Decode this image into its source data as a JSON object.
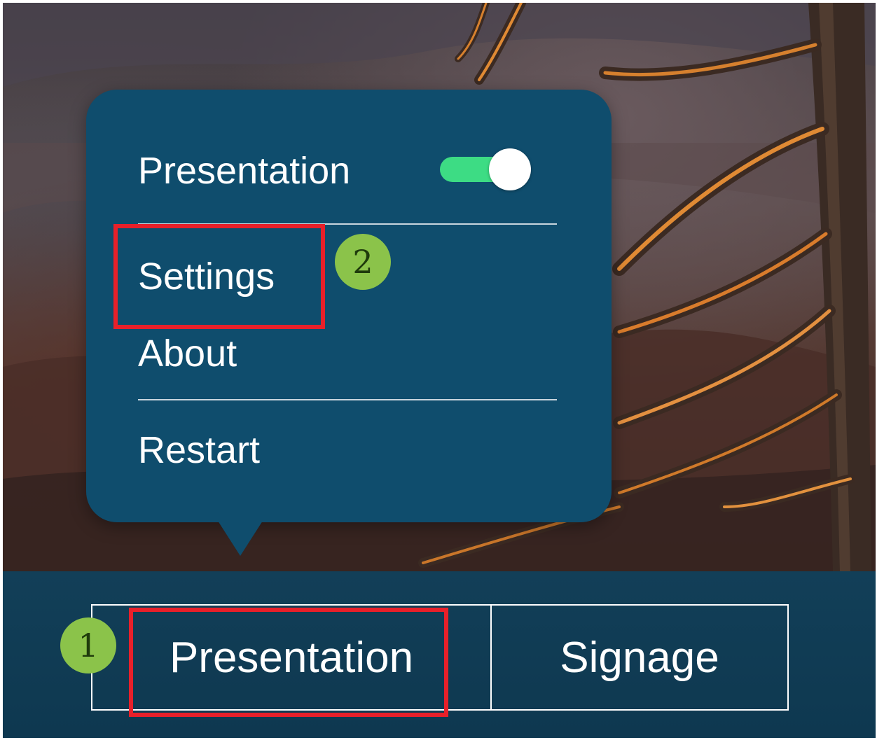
{
  "popup_menu": {
    "toggle_label": "Presentation",
    "toggle_state": "on",
    "items": [
      {
        "label": "Settings"
      },
      {
        "label": "About"
      },
      {
        "label": "Restart"
      }
    ]
  },
  "bottom_tabs": [
    {
      "label": "Presentation"
    },
    {
      "label": "Signage"
    }
  ],
  "annotations": {
    "step1": "1",
    "step2": "2"
  },
  "colors": {
    "popup_bg": "#0f4d6d",
    "bar_bg": "#123f58",
    "toggle_on": "#3ddc84",
    "highlight": "#e8202a",
    "badge": "#8bc34a"
  }
}
